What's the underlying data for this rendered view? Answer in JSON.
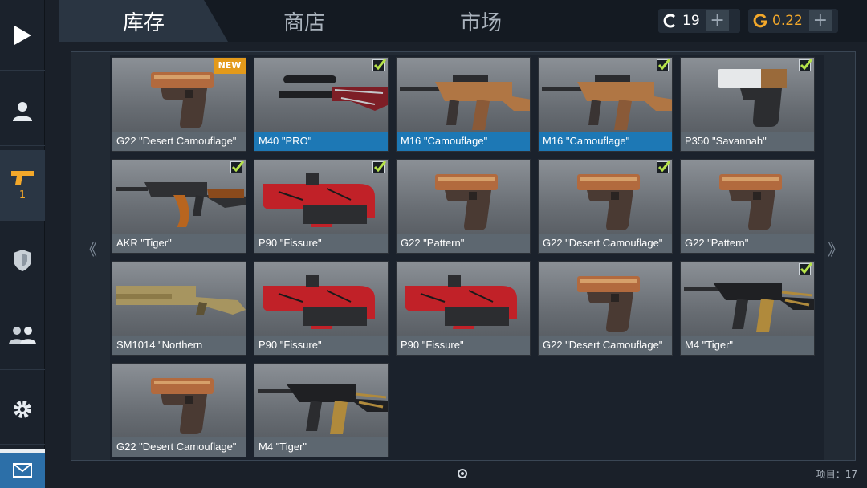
{
  "tabs": [
    {
      "label": "库存",
      "active": true
    },
    {
      "label": "商店",
      "active": false
    },
    {
      "label": "市场",
      "active": false
    }
  ],
  "currencies": {
    "credits": {
      "icon": "c-coin-icon",
      "value": "19",
      "color": "#ffffff"
    },
    "gold": {
      "icon": "g-gold-icon",
      "value": "0.22",
      "color": "#f3a82a"
    }
  },
  "sidebar": {
    "items": [
      {
        "name": "play",
        "icon": "play-icon"
      },
      {
        "name": "profile",
        "icon": "person-icon"
      },
      {
        "name": "inventory",
        "icon": "pistol-icon",
        "badge": "1",
        "active": true
      },
      {
        "name": "clan",
        "icon": "shield-icon"
      },
      {
        "name": "friends",
        "icon": "group-icon"
      },
      {
        "name": "settings",
        "icon": "gear-icon"
      },
      {
        "name": "mail",
        "icon": "envelope-icon"
      }
    ]
  },
  "inventory": {
    "items": [
      {
        "name": "G22 \"Desert Camouflage\"",
        "type": "pistol",
        "badge": "NEW",
        "checked": false,
        "selected": false
      },
      {
        "name": "M40 \"PRO\"",
        "type": "sniper",
        "checked": true,
        "selected": true
      },
      {
        "name": "M16 \"Camouflage\"",
        "type": "rifle",
        "checked": false,
        "selected": true
      },
      {
        "name": "M16 \"Camouflage\"",
        "type": "rifle",
        "checked": true,
        "selected": true
      },
      {
        "name": "P350 \"Savannah\"",
        "type": "pistol-light",
        "checked": true,
        "selected": false
      },
      {
        "name": "AKR \"Tiger\"",
        "type": "ak",
        "checked": true,
        "selected": false
      },
      {
        "name": "P90 \"Fissure\"",
        "type": "smg",
        "checked": true,
        "selected": false
      },
      {
        "name": "G22 \"Pattern\"",
        "type": "pistol",
        "checked": false,
        "selected": false
      },
      {
        "name": "G22 \"Desert Camouflage\"",
        "type": "pistol",
        "checked": true,
        "selected": false
      },
      {
        "name": "G22 \"Pattern\"",
        "type": "pistol",
        "checked": false,
        "selected": false
      },
      {
        "name": "SM1014 \"Northern",
        "type": "shotgun",
        "checked": false,
        "selected": false
      },
      {
        "name": "P90 \"Fissure\"",
        "type": "smg",
        "checked": false,
        "selected": false
      },
      {
        "name": "P90 \"Fissure\"",
        "type": "smg",
        "checked": false,
        "selected": false
      },
      {
        "name": "G22 \"Desert Camouflage\"",
        "type": "pistol",
        "checked": false,
        "selected": false
      },
      {
        "name": "M4 \"Tiger\"",
        "type": "m4",
        "checked": true,
        "selected": false
      },
      {
        "name": "G22 \"Desert Camouflage\"",
        "type": "pistol",
        "checked": false,
        "selected": false
      },
      {
        "name": "M4 \"Tiger\"",
        "type": "m4",
        "checked": false,
        "selected": false
      }
    ],
    "count_label": "项目：17",
    "prev_arrow": "《",
    "next_arrow": "》"
  },
  "colors": {
    "accent": "#1d78b5",
    "gold": "#f3a82a",
    "new_badge": "#e39a1b"
  }
}
